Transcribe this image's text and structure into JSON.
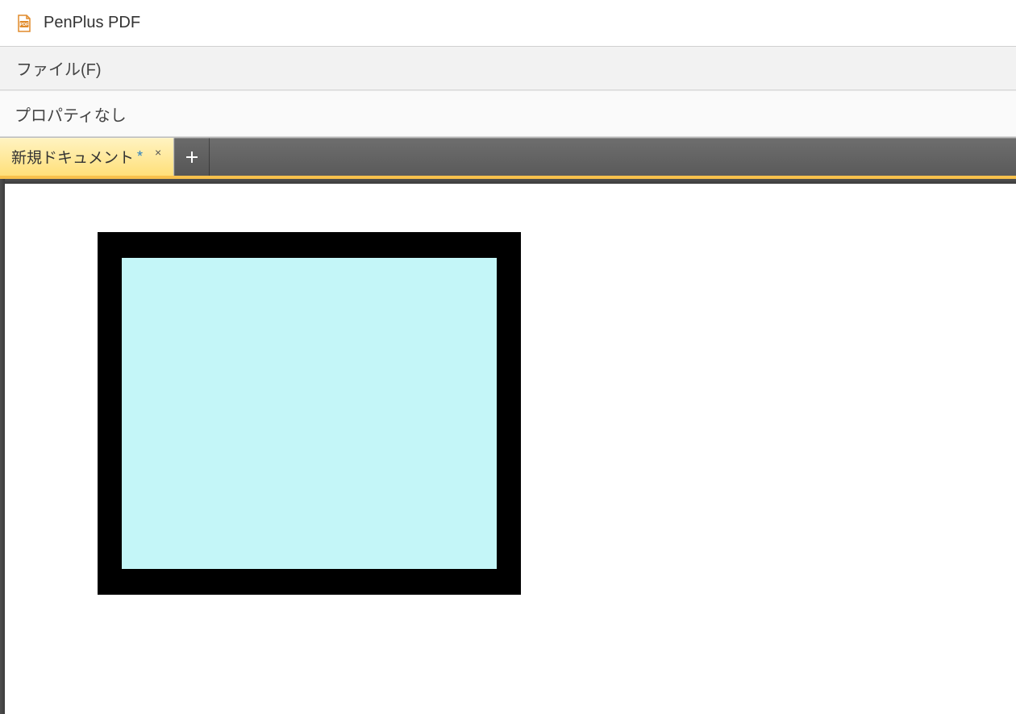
{
  "app": {
    "title": "PenPlus PDF",
    "icon_name": "pdf-file-icon"
  },
  "menu": {
    "file_label": "ファイル(F)"
  },
  "properties_bar": {
    "message": "プロパティなし"
  },
  "tabs": {
    "items": [
      {
        "label": "新規ドキュメント",
        "dirty_marker": "*",
        "close_glyph": "×",
        "active": true
      }
    ],
    "add_symbol": "+"
  },
  "canvas": {
    "shape": {
      "type": "rectangle",
      "border_color": "#000000",
      "fill_color": "#c4f6f8",
      "border_width_px": 30
    }
  }
}
